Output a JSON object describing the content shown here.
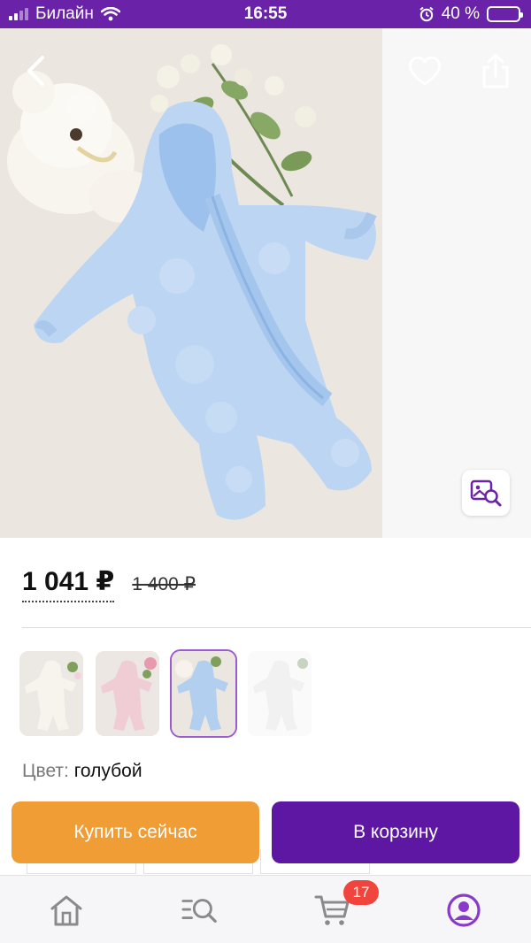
{
  "status_bar": {
    "carrier": "Билайн",
    "time": "16:55",
    "battery_text": "40 %",
    "battery_level": 0.4
  },
  "product": {
    "price_current": "1 041 ₽",
    "price_old": "1 400 ₽",
    "color_label": "Цвет:",
    "color_value": "голубой"
  },
  "thumbnails": [
    {
      "name": "white-variant",
      "color": "#f3eee8"
    },
    {
      "name": "pink-variant",
      "color": "#f1cfd6"
    },
    {
      "name": "blue-variant",
      "color": "#a9c8ec",
      "selected": true
    },
    {
      "name": "light-variant",
      "color": "#f6f6f6"
    }
  ],
  "actions": {
    "buy_now": "Купить сейчас",
    "add_to_cart": "В корзину"
  },
  "tab_bar": {
    "cart_badge": "17",
    "active_tab": "profile"
  },
  "colors": {
    "brand_purple": "#5d17a2",
    "status_purple": "#6a22a8",
    "buy_orange": "#f19d36",
    "badge_red": "#f1443d"
  },
  "icons": [
    "back-icon",
    "heart-icon",
    "share-icon",
    "visual-search-icon",
    "home-icon",
    "catalog-search-icon",
    "cart-icon",
    "profile-icon"
  ]
}
